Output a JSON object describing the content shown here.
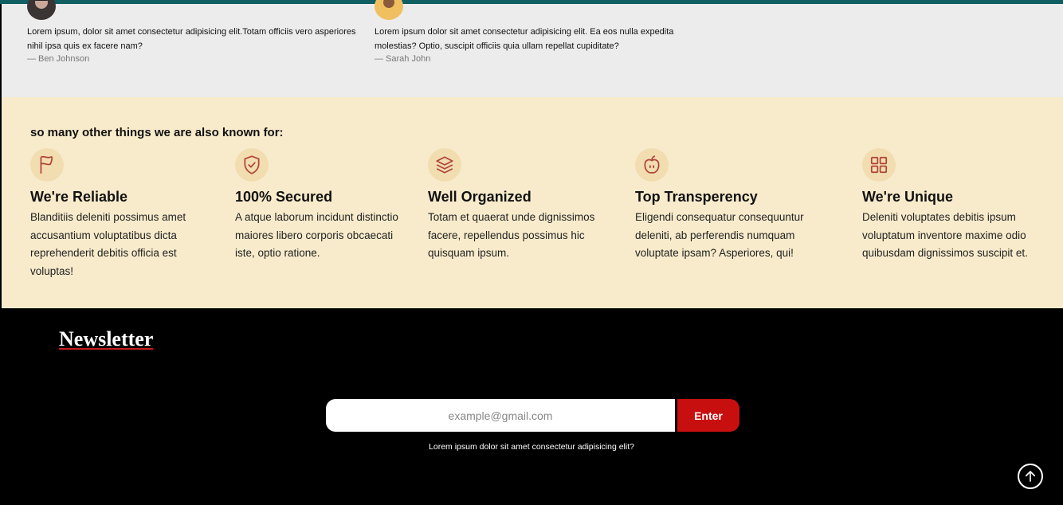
{
  "testimonials": [
    {
      "quote": "Lorem ipsum, dolor sit amet consectetur adipisicing elit.Totam officiis vero asperiores nihil ipsa quis ex facere nam?",
      "author": "— Ben Johnson",
      "avatar": "avatar-man"
    },
    {
      "quote": "Lorem ipsum dolor sit amet consectetur adipisicing elit. Ea eos nulla expedita molestias? Optio, suscipit officiis quia ullam repellat cupiditate?",
      "author": "— Sarah John",
      "avatar": "avatar-woman"
    }
  ],
  "features": {
    "heading": "so many other things we are also known for:",
    "items": [
      {
        "icon": "flag-icon",
        "title": "We're Reliable",
        "text": "Blanditiis deleniti possimus amet accusantium voluptatibus dicta reprehenderit debitis officia est voluptas!"
      },
      {
        "icon": "shield-check-icon",
        "title": "100% Secured",
        "text": "A atque laborum incidunt distinctio maiores libero corporis obcaecati iste, optio ratione."
      },
      {
        "icon": "layers-icon",
        "title": "Well Organized",
        "text": "Totam et quaerat unde dignissimos facere, repellendus possimus hic quisquam ipsum."
      },
      {
        "icon": "apple-icon",
        "title": "Top Transperency",
        "text": "Eligendi consequatur consequuntur deleniti, ab perferendis numquam voluptate ipsam? Asperiores, qui!"
      },
      {
        "icon": "grid-icon",
        "title": "We're Unique",
        "text": "Deleniti voluptates debitis ipsum voluptatum inventore maxime odio quibusdam dignissimos suscipit et."
      }
    ]
  },
  "newsletter": {
    "title": "Newsletter",
    "placeholder": "example@gmail.com",
    "button_label": "Enter",
    "note": "Lorem ipsum dolor sit amet consectetur adipisicing elit?"
  },
  "colors": {
    "topbar": "#0f5f63",
    "features_bg": "#f8ebcb",
    "accent_red": "#c80f0f",
    "icon_color": "#b0443a"
  }
}
